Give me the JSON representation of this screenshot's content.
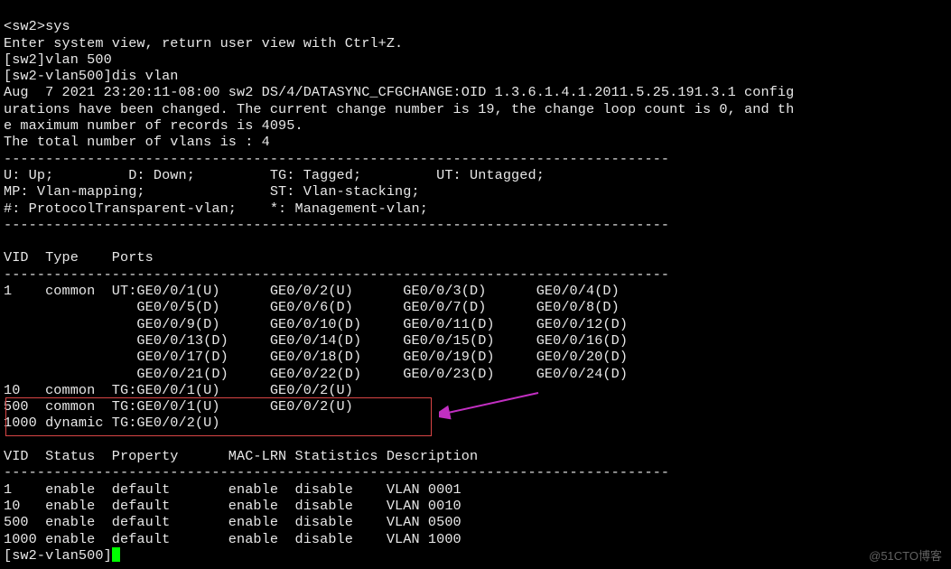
{
  "prompt1_host": "<sw2>",
  "prompt1_cmd": "sys",
  "enter_sysview": "Enter system view, return user view with Ctrl+Z.",
  "prompt2_host": "[sw2]",
  "prompt2_cmd": "vlan 500",
  "prompt3_host": "[sw2-vlan500]",
  "prompt3_cmd": "dis vlan",
  "log_line1": "Aug  7 2021 23:20:11-08:00 sw2 DS/4/DATASYNC_CFGCHANGE:OID 1.3.6.1.4.1.2011.5.25.191.3.1 config",
  "log_line2": "urations have been changed. The current change number is 19, the change loop count is 0, and th",
  "log_line3": "e maximum number of records is 4095.",
  "total_vlans": "The total number of vlans is : 4",
  "dash_line": "--------------------------------------------------------------------------------",
  "legend_line1": "U: Up;         D: Down;         TG: Tagged;         UT: Untagged;",
  "legend_line2": "MP: Vlan-mapping;               ST: Vlan-stacking;",
  "legend_line3": "#: ProtocolTransparent-vlan;    *: Management-vlan;",
  "ports_header": "VID  Type    Ports",
  "ports_row1": "1    common  UT:GE0/0/1(U)      GE0/0/2(U)      GE0/0/3(D)      GE0/0/4(D)",
  "ports_row1b": "                GE0/0/5(D)      GE0/0/6(D)      GE0/0/7(D)      GE0/0/8(D)",
  "ports_row1c": "                GE0/0/9(D)      GE0/0/10(D)     GE0/0/11(D)     GE0/0/12(D)",
  "ports_row1d": "                GE0/0/13(D)     GE0/0/14(D)     GE0/0/15(D)     GE0/0/16(D)",
  "ports_row1e": "                GE0/0/17(D)     GE0/0/18(D)     GE0/0/19(D)     GE0/0/20(D)",
  "ports_row1f": "                GE0/0/21(D)     GE0/0/22(D)     GE0/0/23(D)     GE0/0/24(D)",
  "ports_row2": "10   common  TG:GE0/0/1(U)      GE0/0/2(U)",
  "ports_row3": "500  common  TG:GE0/0/1(U)      GE0/0/2(U)",
  "ports_row4": "1000 dynamic TG:GE0/0/2(U)",
  "blank": "",
  "status_header": "VID  Status  Property      MAC-LRN Statistics Description",
  "status_row1": "1    enable  default       enable  disable    VLAN 0001",
  "status_row2": "10   enable  default       enable  disable    VLAN 0010",
  "status_row3": "500  enable  default       enable  disable    VLAN 0500",
  "status_row4": "1000 enable  default       enable  disable    VLAN 1000",
  "prompt4_host": "[sw2-vlan500]",
  "watermark": "@51CTO博客",
  "chart_data": {
    "type": "table",
    "vlan_ports": [
      {
        "vid": 1,
        "type": "common",
        "ports": [
          "UT:GE0/0/1(U)",
          "GE0/0/2(U)",
          "GE0/0/3(D)",
          "GE0/0/4(D)",
          "GE0/0/5(D)",
          "GE0/0/6(D)",
          "GE0/0/7(D)",
          "GE0/0/8(D)",
          "GE0/0/9(D)",
          "GE0/0/10(D)",
          "GE0/0/11(D)",
          "GE0/0/12(D)",
          "GE0/0/13(D)",
          "GE0/0/14(D)",
          "GE0/0/15(D)",
          "GE0/0/16(D)",
          "GE0/0/17(D)",
          "GE0/0/18(D)",
          "GE0/0/19(D)",
          "GE0/0/20(D)",
          "GE0/0/21(D)",
          "GE0/0/22(D)",
          "GE0/0/23(D)",
          "GE0/0/24(D)"
        ]
      },
      {
        "vid": 10,
        "type": "common",
        "ports": [
          "TG:GE0/0/1(U)",
          "GE0/0/2(U)"
        ]
      },
      {
        "vid": 500,
        "type": "common",
        "ports": [
          "TG:GE0/0/1(U)",
          "GE0/0/2(U)"
        ]
      },
      {
        "vid": 1000,
        "type": "dynamic",
        "ports": [
          "TG:GE0/0/2(U)"
        ]
      }
    ],
    "vlan_status": [
      {
        "vid": 1,
        "status": "enable",
        "property": "default",
        "mac_lrn": "enable",
        "statistics": "disable",
        "description": "VLAN 0001"
      },
      {
        "vid": 10,
        "status": "enable",
        "property": "default",
        "mac_lrn": "enable",
        "statistics": "disable",
        "description": "VLAN 0010"
      },
      {
        "vid": 500,
        "status": "enable",
        "property": "default",
        "mac_lrn": "enable",
        "statistics": "disable",
        "description": "VLAN 0500"
      },
      {
        "vid": 1000,
        "status": "enable",
        "property": "default",
        "mac_lrn": "enable",
        "statistics": "disable",
        "description": "VLAN 1000"
      }
    ]
  }
}
